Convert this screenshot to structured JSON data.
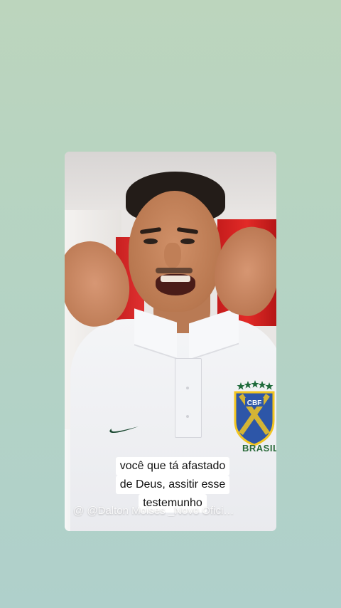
{
  "video": {
    "caption_lines": [
      "você que tá afastado",
      "de Deus, assitir esse",
      "testemunho"
    ],
    "watermark": "@ @Dalton Moises _Novo Ofici…",
    "shirt_crest_text": "BRASIL",
    "shirt_crest_abbrev": "CBF"
  },
  "colors": {
    "background_top": "#bcd5bd",
    "background_bottom": "#afd0cb",
    "caption_bg": "#ffffff",
    "caption_text": "#111111"
  }
}
